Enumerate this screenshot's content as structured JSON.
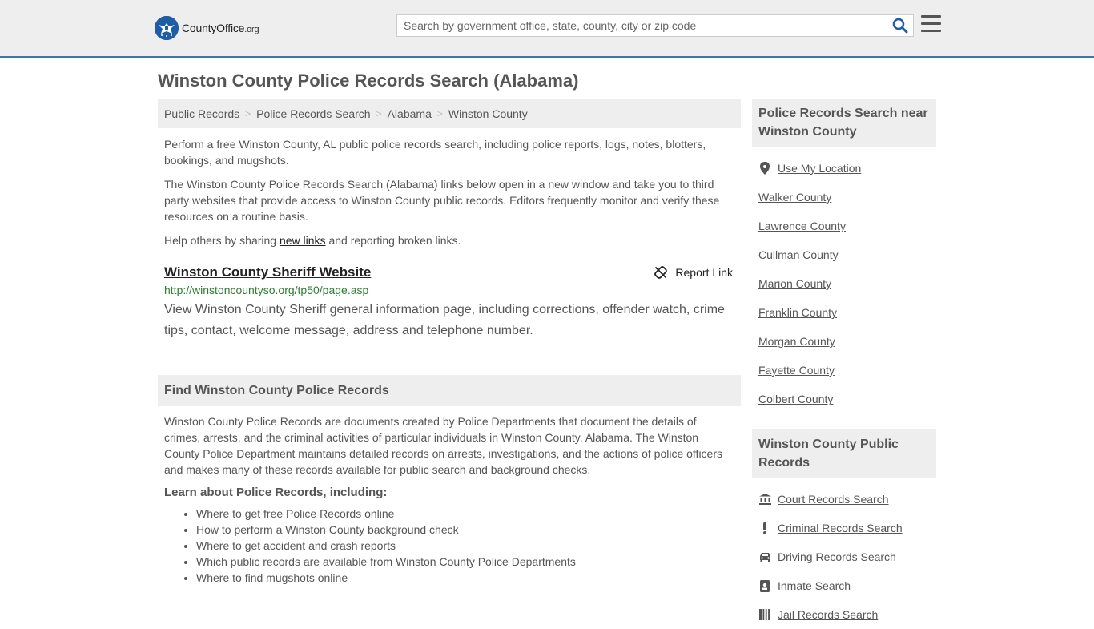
{
  "header": {
    "logo_main": "CountyOffice",
    "logo_org": ".org",
    "search_placeholder": "Search by government office, state, county, city or zip code"
  },
  "page_title": "Winston County Police Records Search (Alabama)",
  "breadcrumb": [
    "Public Records",
    "Police Records Search",
    "Alabama",
    "Winston County"
  ],
  "intro": {
    "p1": "Perform a free Winston County, AL public police records search, including police reports, logs, notes, blotters, bookings, and mugshots.",
    "p2": "The Winston County Police Records Search (Alabama) links below open in a new window and take you to third party websites that provide access to Winston County public records. Editors frequently monitor and verify these resources on a routine basis.",
    "p3_before": "Help others by sharing ",
    "p3_link": "new links",
    "p3_after": " and reporting broken links."
  },
  "listing": {
    "title": "Winston County Sheriff Website",
    "report_label": "Report Link",
    "url": "http://winstoncountyso.org/tp50/page.asp",
    "description": "View Winston County Sheriff general information page, including corrections, offender watch, crime tips, contact, welcome message, address and telephone number."
  },
  "find_section": {
    "heading": "Find Winston County Police Records",
    "paragraph": "Winston County Police Records are documents created by Police Departments that document the details of crimes, arrests, and the criminal activities of particular individuals in Winston County, Alabama. The Winston County Police Department maintains detailed records on arrests, investigations, and the actions of police officers and makes many of these records available for public search and background checks.",
    "learn_heading": "Learn about Police Records, including:",
    "learn_items": [
      "Where to get free Police Records online",
      "How to perform a Winston County background check",
      "Where to get accident and crash reports",
      "Which public records are available from Winston County Police Departments",
      "Where to find mugshots online"
    ]
  },
  "sidebar": {
    "nearby_heading": "Police Records Search near Winston County",
    "use_location": "Use My Location",
    "nearby": [
      "Walker County",
      "Lawrence County",
      "Cullman County",
      "Marion County",
      "Franklin County",
      "Morgan County",
      "Fayette County",
      "Colbert County"
    ],
    "public_heading": "Winston County Public Records",
    "public_records": [
      {
        "label": "Court Records Search",
        "icon": "courthouse-icon"
      },
      {
        "label": "Criminal Records Search",
        "icon": "exclamation-icon"
      },
      {
        "label": "Driving Records Search",
        "icon": "car-icon"
      },
      {
        "label": "Inmate Search",
        "icon": "id-badge-icon"
      },
      {
        "label": "Jail Records Search",
        "icon": "jail-icon"
      }
    ]
  }
}
